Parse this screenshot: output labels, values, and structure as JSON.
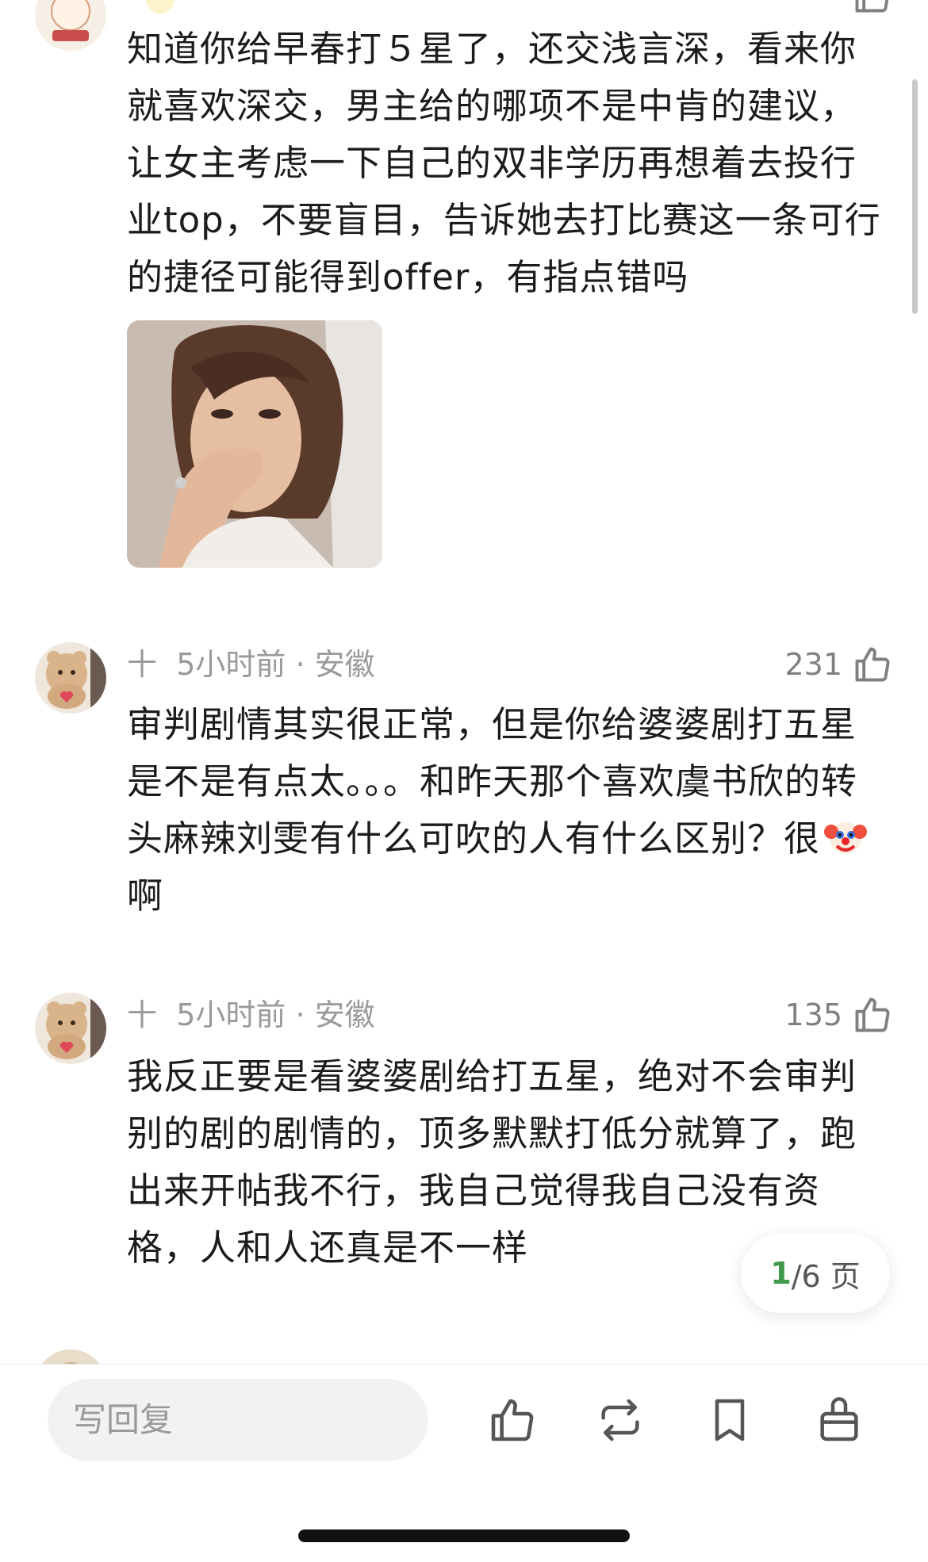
{
  "comments": [
    {
      "text": "知道你给早春打５星了，还交浅言深，看来你就喜欢深交，男主给的哪项不是中肯的建议，让女主考虑一下自己的双非学历再想着去投行业top，不要盲目，告诉她去打比赛这一条可行的捷径可能得到offer，有指点错吗"
    },
    {
      "author": "十",
      "time": "5小时前",
      "location": "安徽",
      "likes": "231",
      "text_before": "审判剧情其实很正常，但是你给婆婆剧打五星是不是有点太。。。和昨天那个喜欢虞书欣的转头麻辣刘雯有什么可吹的人有什么区别？很",
      "emoji": "clown-face-emoji",
      "text_after": "啊"
    },
    {
      "author": "十",
      "time": "5小时前",
      "location": "安徽",
      "likes": "135",
      "text": "我反正要是看婆婆剧给打五星，绝对不会审判别的剧的剧情的，顶多默默打低分就算了，跑出来开帖我不行，我自己觉得我自己没有资格，人和人还真是不一样"
    }
  ],
  "pager": {
    "current": "1",
    "total": "/6 页"
  },
  "bottom_bar": {
    "reply_placeholder": "写回复",
    "icons": [
      "thumbs-up-icon",
      "repost-icon",
      "bookmark-icon",
      "gift-icon"
    ]
  },
  "colors": {
    "accent_green": "#3f9a4b",
    "meta_gray": "#9a9a9a",
    "badge_bg": "#fdf2c9"
  }
}
